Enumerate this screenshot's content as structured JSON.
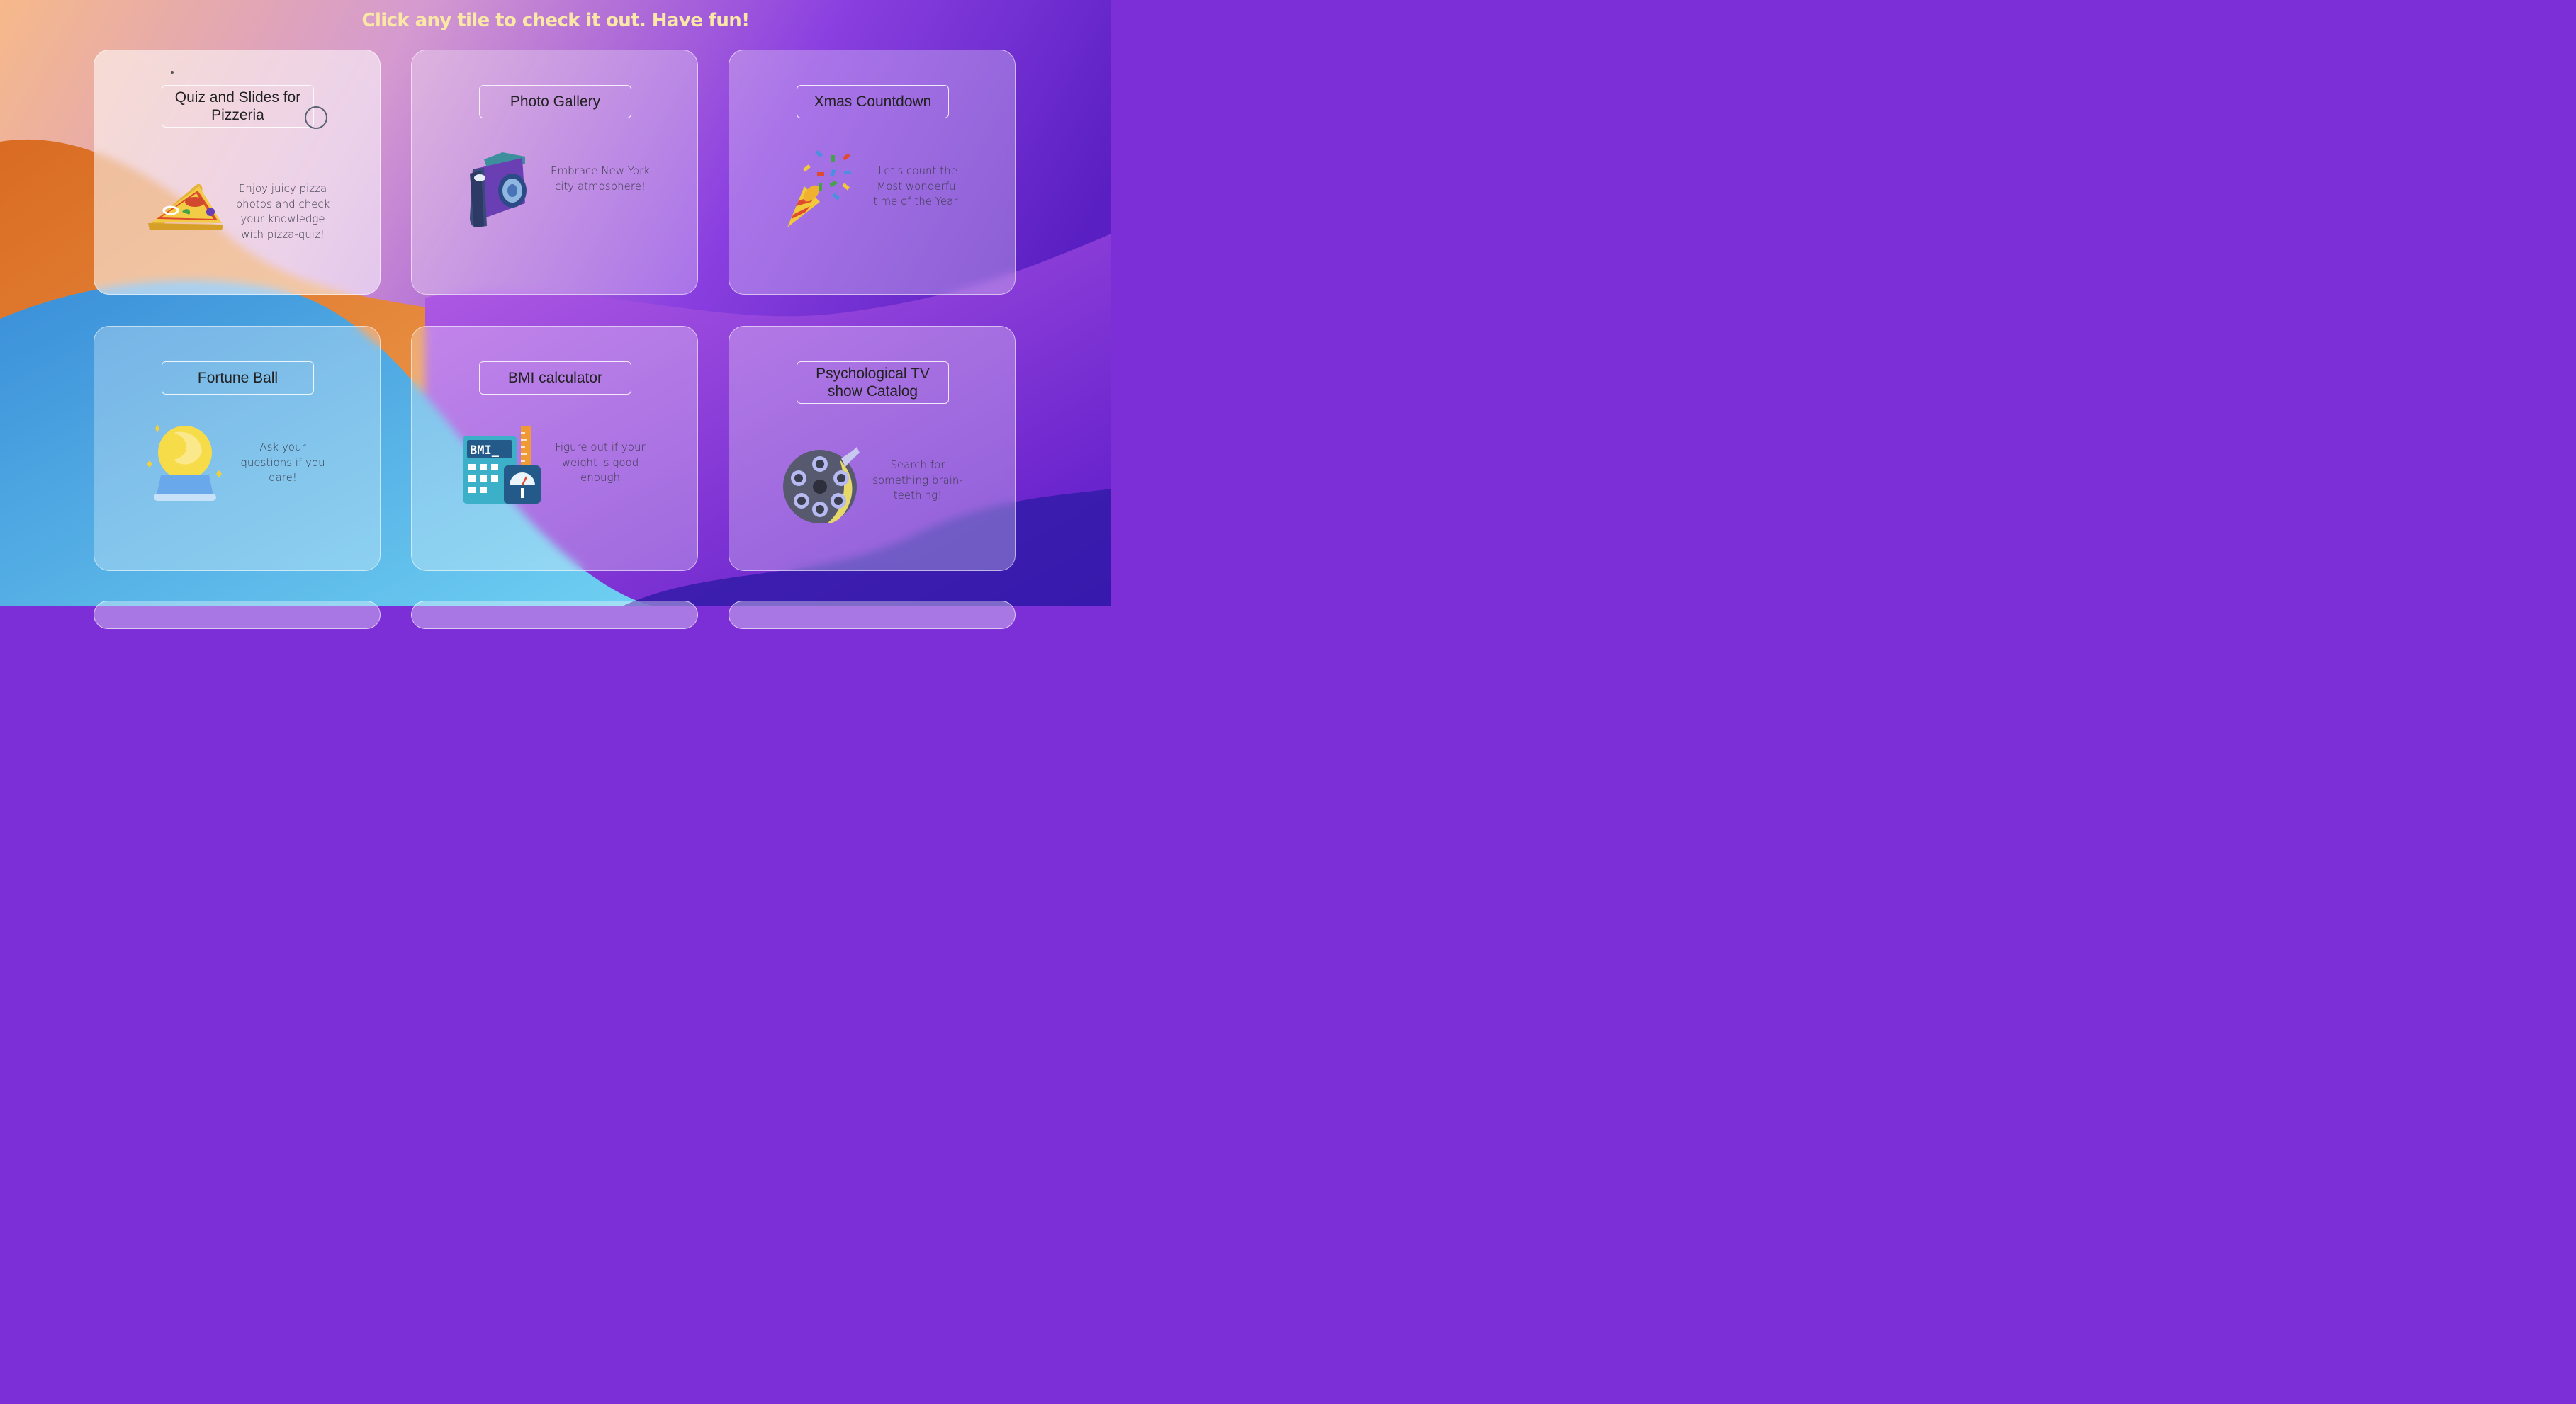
{
  "headline": "Click any tile to check it out. Have fun!",
  "tiles": [
    {
      "title": "Quiz and Slides for Pizzeria",
      "description": "Enjoy juicy pizza photos and check your knowledge with pizza-quiz!",
      "icon": "pizza-slice-icon"
    },
    {
      "title": "Photo Gallery",
      "description": "Embrace New York city atmosphere!",
      "icon": "camera-icon"
    },
    {
      "title": "Xmas Countdown",
      "description": "Let's count the Most wonderful time of the Year!",
      "icon": "party-popper-icon"
    },
    {
      "title": "Fortune Ball",
      "description": "Ask your questions if you dare!",
      "icon": "crystal-ball-icon"
    },
    {
      "title": "BMI calculator",
      "description": "Figure out if your weight is good enough",
      "icon": "calculator-scale-icon"
    },
    {
      "title": "Psychological TV show Catalog",
      "description": "Search for something brain-teething!",
      "icon": "film-reel-icon"
    }
  ],
  "colors": {
    "headline": "#fbe7a6",
    "background_purple": "#7c2fd6",
    "background_orange": "#e58a3a",
    "background_blue": "#4fb6e6"
  }
}
